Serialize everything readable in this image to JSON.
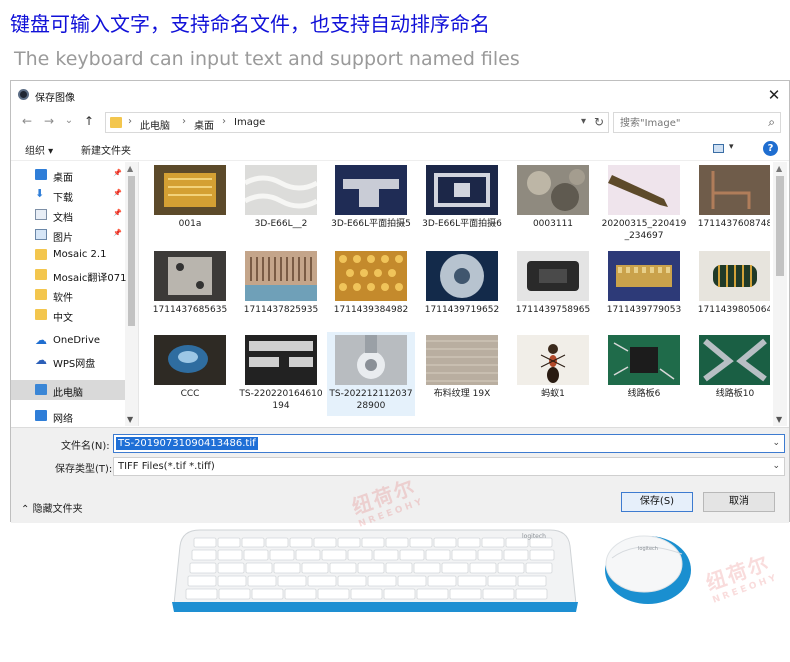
{
  "banner": {
    "title_cn": "键盘可输入文字，支持命名文件，也支持自动排序命名",
    "title_en": "The keyboard can input text and support named files"
  },
  "dialog": {
    "title": "保存图像",
    "close_symbol": "✕",
    "nav": {
      "back": "←",
      "forward": "→",
      "recent": "⌄",
      "up": "↑",
      "breadcrumb": [
        "此电脑",
        "桌面",
        "Image"
      ],
      "crumb_separator": "›",
      "search_placeholder": "搜索\"Image\""
    },
    "toolbar": {
      "organize": "组织 ▾",
      "new_folder": "新建文件夹",
      "help": "?"
    },
    "sidebar": [
      {
        "label": "桌面",
        "icon": "desktop-icon",
        "pinned": true
      },
      {
        "label": "下载",
        "icon": "download-icon",
        "pinned": true
      },
      {
        "label": "文档",
        "icon": "document-icon",
        "pinned": true
      },
      {
        "label": "图片",
        "icon": "pictures-icon",
        "pinned": true
      },
      {
        "label": "Mosaic 2.1",
        "icon": "folder-icon",
        "pinned": false
      },
      {
        "label": "Mosaic翻译071",
        "icon": "folder-icon",
        "pinned": false
      },
      {
        "label": "软件",
        "icon": "folder-icon",
        "pinned": false
      },
      {
        "label": "中文",
        "icon": "folder-icon",
        "pinned": false
      },
      {
        "label": "OneDrive",
        "icon": "cloud-icon",
        "pinned": false
      },
      {
        "label": "WPS网盘",
        "icon": "wps-cloud-icon",
        "pinned": false
      },
      {
        "label": "此电脑",
        "icon": "computer-icon",
        "pinned": false
      },
      {
        "label": "网络",
        "icon": "network-icon",
        "pinned": false
      }
    ],
    "files": [
      {
        "name": "001a"
      },
      {
        "name": "3D-E66L__2"
      },
      {
        "name": "3D-E66L平面拍摄5"
      },
      {
        "name": "3D-E66L平面拍摄6"
      },
      {
        "name": "0003111"
      },
      {
        "name": "20200315_220419_234697"
      },
      {
        "name": "1711437608748"
      },
      {
        "name": "1711437685635"
      },
      {
        "name": "1711437825935"
      },
      {
        "name": "1711439384982"
      },
      {
        "name": "1711439719652"
      },
      {
        "name": "1711439758965"
      },
      {
        "name": "1711439779053"
      },
      {
        "name": "1711439805064"
      },
      {
        "name": "CCC"
      },
      {
        "name": "TS-220220164610194"
      },
      {
        "name": "TS-20221211203728900"
      },
      {
        "name": "布料纹理 19X"
      },
      {
        "name": "蚂蚁1"
      },
      {
        "name": "线路板6"
      },
      {
        "name": "线路板10"
      }
    ],
    "form": {
      "filename_label": "文件名(N):",
      "filename_value": "TS-20190731090413486.tif",
      "filetype_label": "保存类型(T):",
      "filetype_value": "TIFF Files(*.tif *.tiff)",
      "hide_folders": "隐藏文件夹",
      "save": "保存(S)",
      "cancel": "取消"
    }
  },
  "watermark": {
    "cn": "纽荷尔",
    "en": "NREEOHY"
  },
  "product": {
    "keyboard_brand": "logitech",
    "mouse_brand": "logitech"
  }
}
